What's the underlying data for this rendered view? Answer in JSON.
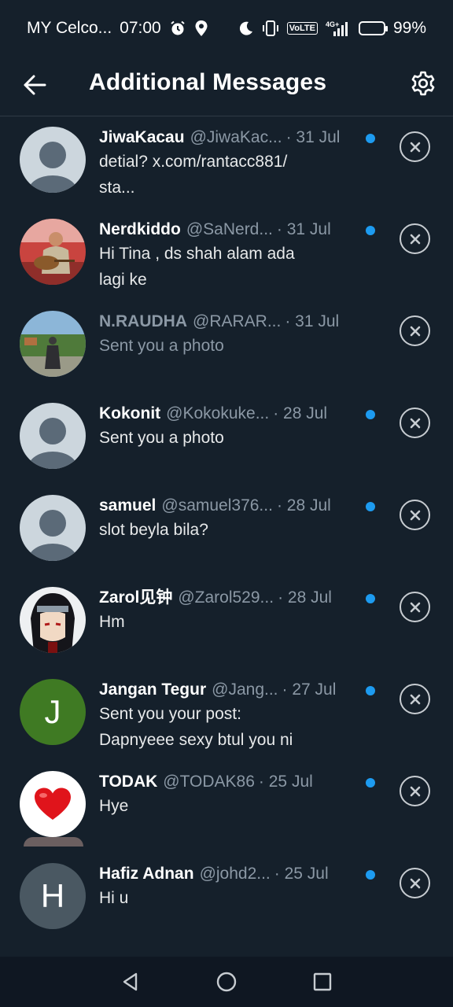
{
  "status_bar": {
    "carrier": "MY Celco...",
    "time": "07:00",
    "network": "4G+",
    "volte": "VoLTE",
    "battery": "99%"
  },
  "header": {
    "title": "Additional Messages",
    "back_icon": "arrow-left-icon",
    "settings_icon": "gear-icon"
  },
  "messages": [
    {
      "name": "JiwaKacau",
      "handle": "@JiwaKac...",
      "date": "· 31 Jul",
      "preview": [
        "detial? x.com/rantacc881/",
        "sta..."
      ],
      "unread": true,
      "avatar": "default"
    },
    {
      "name": "Nerdkiddo",
      "handle": "@SaNerd...",
      "date": "· 31 Jul",
      "preview": [
        "Hi Tina , ds shah alam ada",
        "lagi ke"
      ],
      "unread": true,
      "avatar": "photo-guitar"
    },
    {
      "name": "N.RAUDHA",
      "handle": "@RARAR...",
      "date": "· 31 Jul",
      "preview": [
        "Sent you a photo"
      ],
      "unread": false,
      "avatar": "photo-outdoor"
    },
    {
      "name": "Kokonit",
      "handle": "@Kokokuke...",
      "date": "· 28 Jul",
      "preview": [
        "Sent you a photo"
      ],
      "unread": true,
      "avatar": "default"
    },
    {
      "name": "samuel",
      "handle": "@samuel376...",
      "date": "· 28 Jul",
      "preview": [
        "slot beyla bila?"
      ],
      "unread": true,
      "avatar": "default"
    },
    {
      "name": "Zarol见钟",
      "handle": "@Zarol529...",
      "date": "· 28 Jul",
      "preview": [
        "Hm"
      ],
      "unread": true,
      "avatar": "photo-anime"
    },
    {
      "name": "Jangan Tegur",
      "handle": "@Jang...",
      "date": "· 27 Jul",
      "preview": [
        "Sent you your post:",
        "Dapnyeee sexy btul you ni"
      ],
      "unread": true,
      "avatar": "letter",
      "letter": "J",
      "avatar_color": "#3f7a23"
    },
    {
      "name": "TODAK",
      "handle": "@TODAK86",
      "date": "· 25 Jul",
      "preview": [
        "Hye"
      ],
      "unread": true,
      "avatar": "heart"
    },
    {
      "name": "Hafiz Adnan",
      "handle": "@johd2...",
      "date": "· 25 Jul",
      "preview": [
        "Hi u"
      ],
      "unread": true,
      "avatar": "letter",
      "letter": "H",
      "avatar_color": "#4a5862"
    }
  ],
  "nav_bar": {
    "back_icon": "triangle-back-icon",
    "home_icon": "circle-home-icon",
    "recents_icon": "square-recents-icon"
  },
  "colors": {
    "background": "#15202b",
    "accent": "#1d9bf0",
    "muted_text": "#8b98a5"
  }
}
